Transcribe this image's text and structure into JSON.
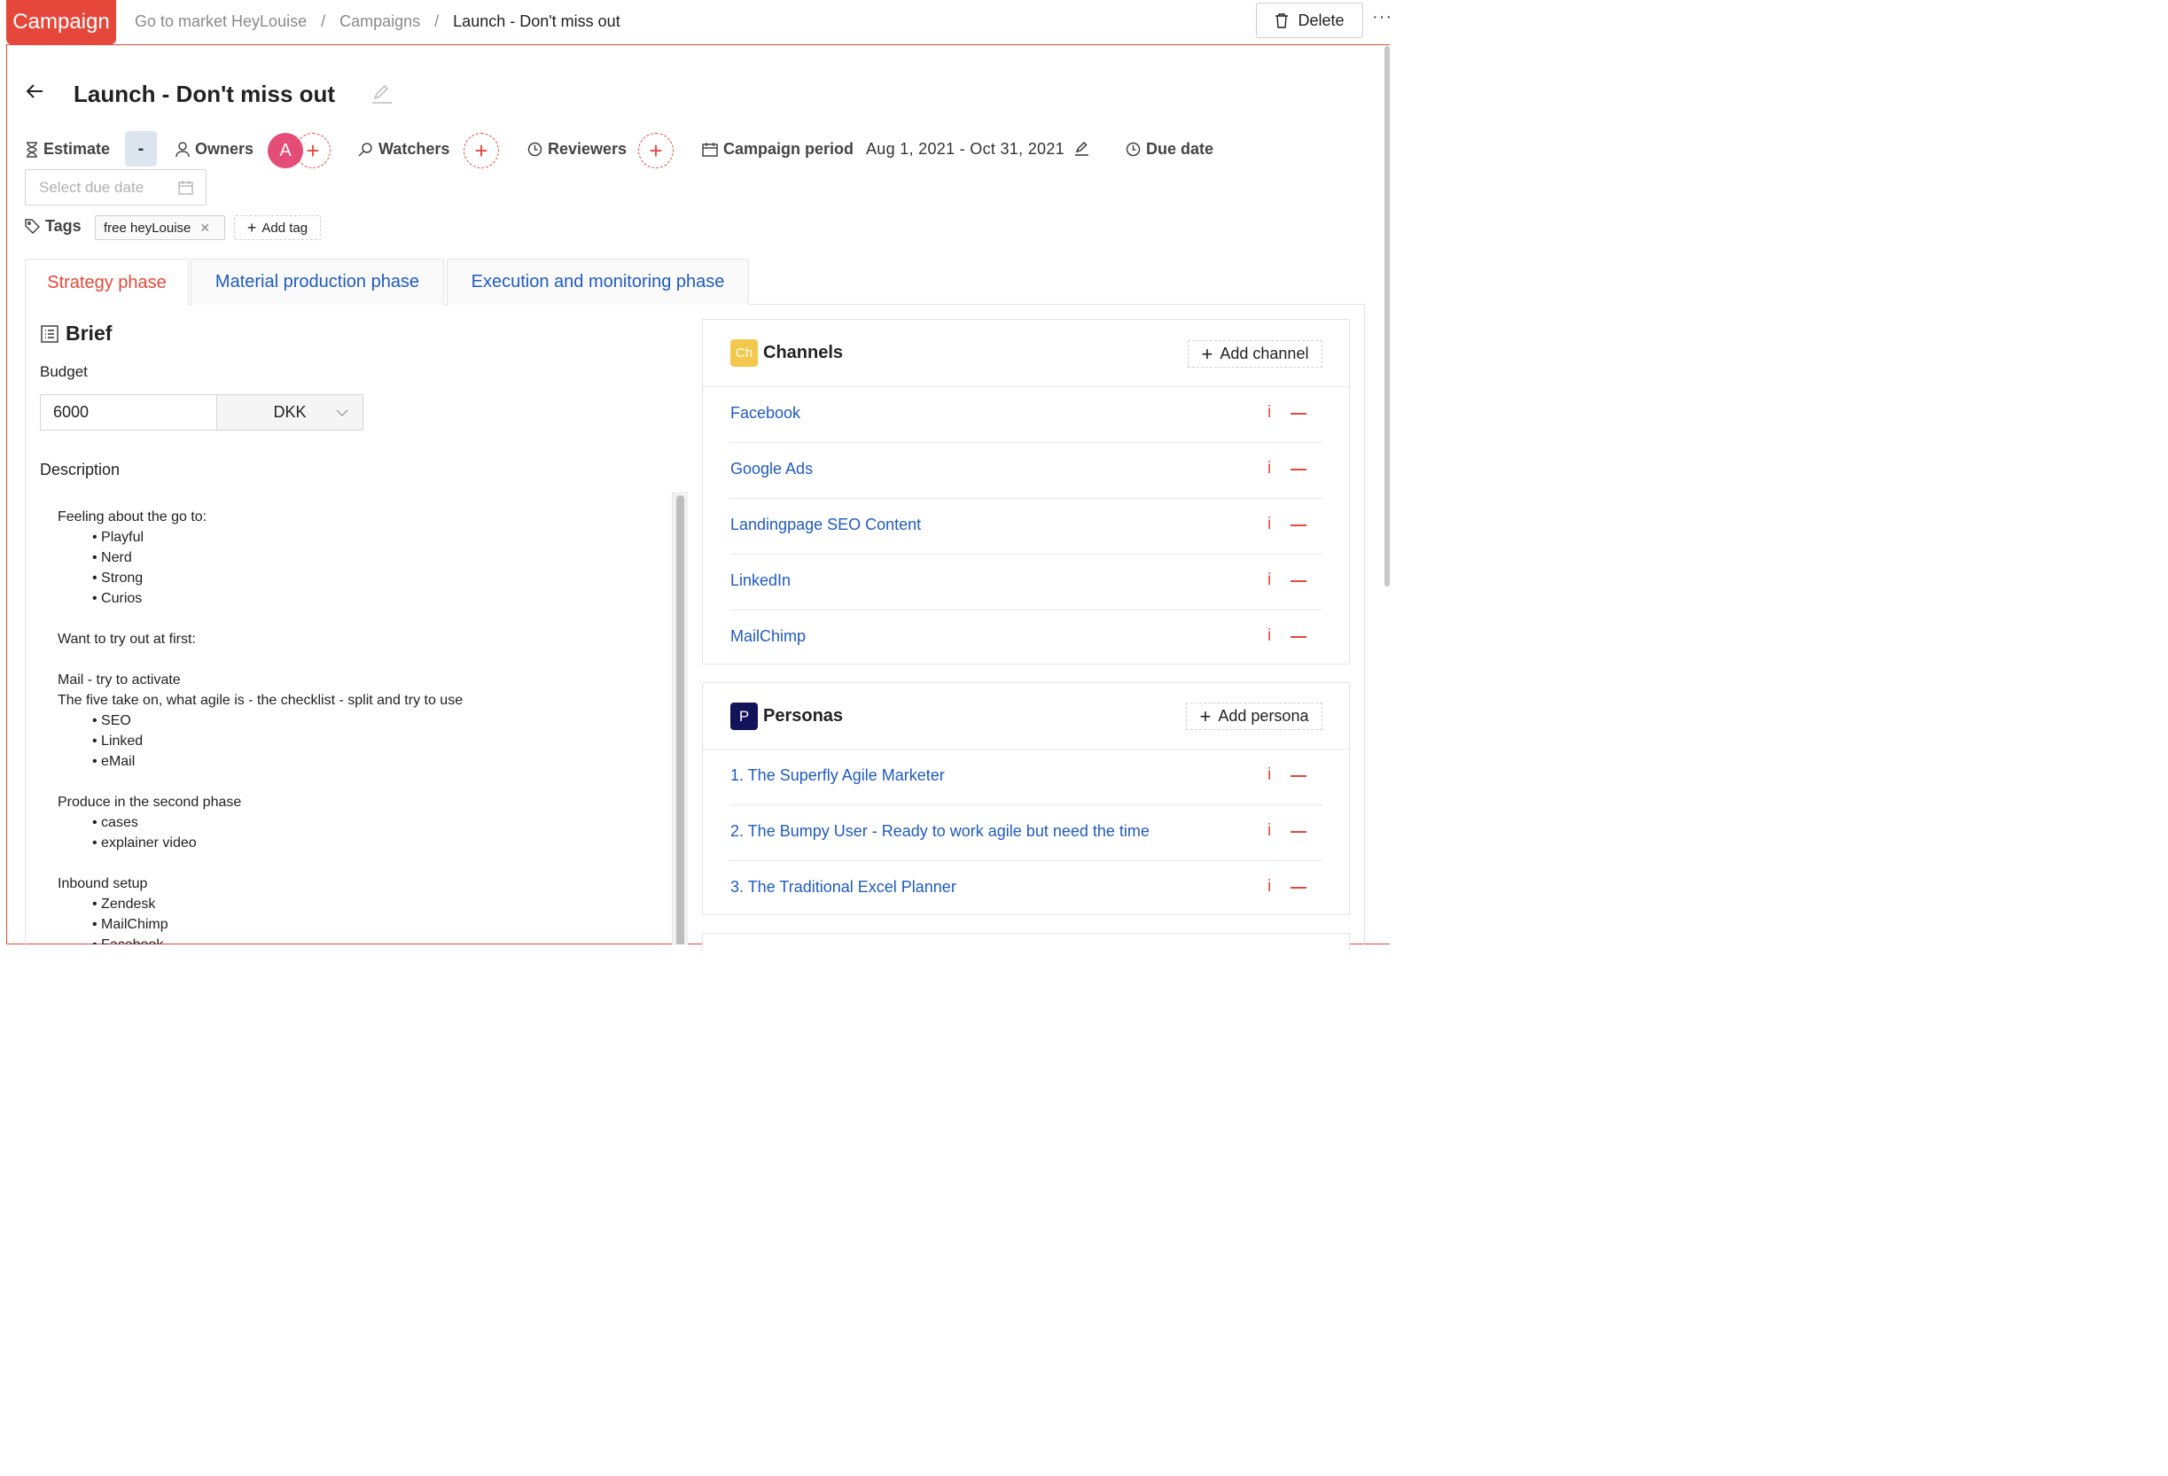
{
  "header": {
    "badge": "Campaign",
    "breadcrumb": [
      "Go to market HeyLouise",
      "Campaigns",
      "Launch - Don't miss out"
    ],
    "separator": "/",
    "delete_label": "Delete",
    "more_label": "···"
  },
  "title": "Launch - Don't miss out",
  "meta": {
    "estimate_label": "Estimate",
    "estimate_value": "-",
    "owners_label": "Owners",
    "owner_avatar": "A",
    "watchers_label": "Watchers",
    "reviewers_label": "Reviewers",
    "period_label": "Campaign period",
    "period_value": "Aug 1, 2021 - Oct 31, 2021",
    "due_label": "Due date",
    "due_placeholder": "Select due date"
  },
  "tags": {
    "label": "Tags",
    "items": [
      "free heyLouise"
    ],
    "add_label": "Add tag"
  },
  "tabs": [
    "Strategy phase",
    "Material production phase",
    "Execution and monitoring phase"
  ],
  "active_tab": "Strategy phase",
  "brief": {
    "title": "Brief",
    "budget_label": "Budget",
    "budget_value": "6000",
    "currency": "DKK",
    "description_label": "Description",
    "description_lines": [
      {
        "text": "Feeling about the go to:",
        "bullet": false
      },
      {
        "text": "• Playful",
        "bullet": true
      },
      {
        "text": "• Nerd",
        "bullet": true
      },
      {
        "text": "• Strong",
        "bullet": true
      },
      {
        "text": "• Curios",
        "bullet": true
      },
      {
        "text": "",
        "bullet": false
      },
      {
        "text": "Want to try out at first:",
        "bullet": false
      },
      {
        "text": "",
        "bullet": false
      },
      {
        "text": "Mail - try to activate",
        "bullet": false
      },
      {
        "text": "The five take on, what agile is - the checklist - split and try to use",
        "bullet": false
      },
      {
        "text": "• SEO",
        "bullet": true
      },
      {
        "text": "• Linked",
        "bullet": true
      },
      {
        "text": "• eMail",
        "bullet": true
      },
      {
        "text": "",
        "bullet": false
      },
      {
        "text": "Produce in the second phase",
        "bullet": false
      },
      {
        "text": "• cases",
        "bullet": true
      },
      {
        "text": "• explainer video",
        "bullet": true
      },
      {
        "text": "",
        "bullet": false
      },
      {
        "text": "Inbound setup",
        "bullet": false
      },
      {
        "text": "• Zendesk",
        "bullet": true
      },
      {
        "text": "• MailChimp",
        "bullet": true
      },
      {
        "text": "• Facebook",
        "bullet": true
      }
    ]
  },
  "channels": {
    "badge": "Ch",
    "title": "Channels",
    "add_label": "Add channel",
    "items": [
      "Facebook",
      "Google Ads",
      "Landingpage SEO Content",
      "LinkedIn",
      "MailChimp"
    ]
  },
  "personas": {
    "badge": "P",
    "title": "Personas",
    "add_label": "Add persona",
    "items": [
      "1. The Superfly Agile Marketer",
      "2. The Bumpy User - Ready to work agile but need the time",
      "3. The Traditional Excel Planner"
    ]
  },
  "colors": {
    "accent": "#e5483b",
    "link": "#1f5bbf",
    "avatar": "#e44d78",
    "channels_badge": "#f2c94c",
    "personas_badge": "#13135a"
  }
}
